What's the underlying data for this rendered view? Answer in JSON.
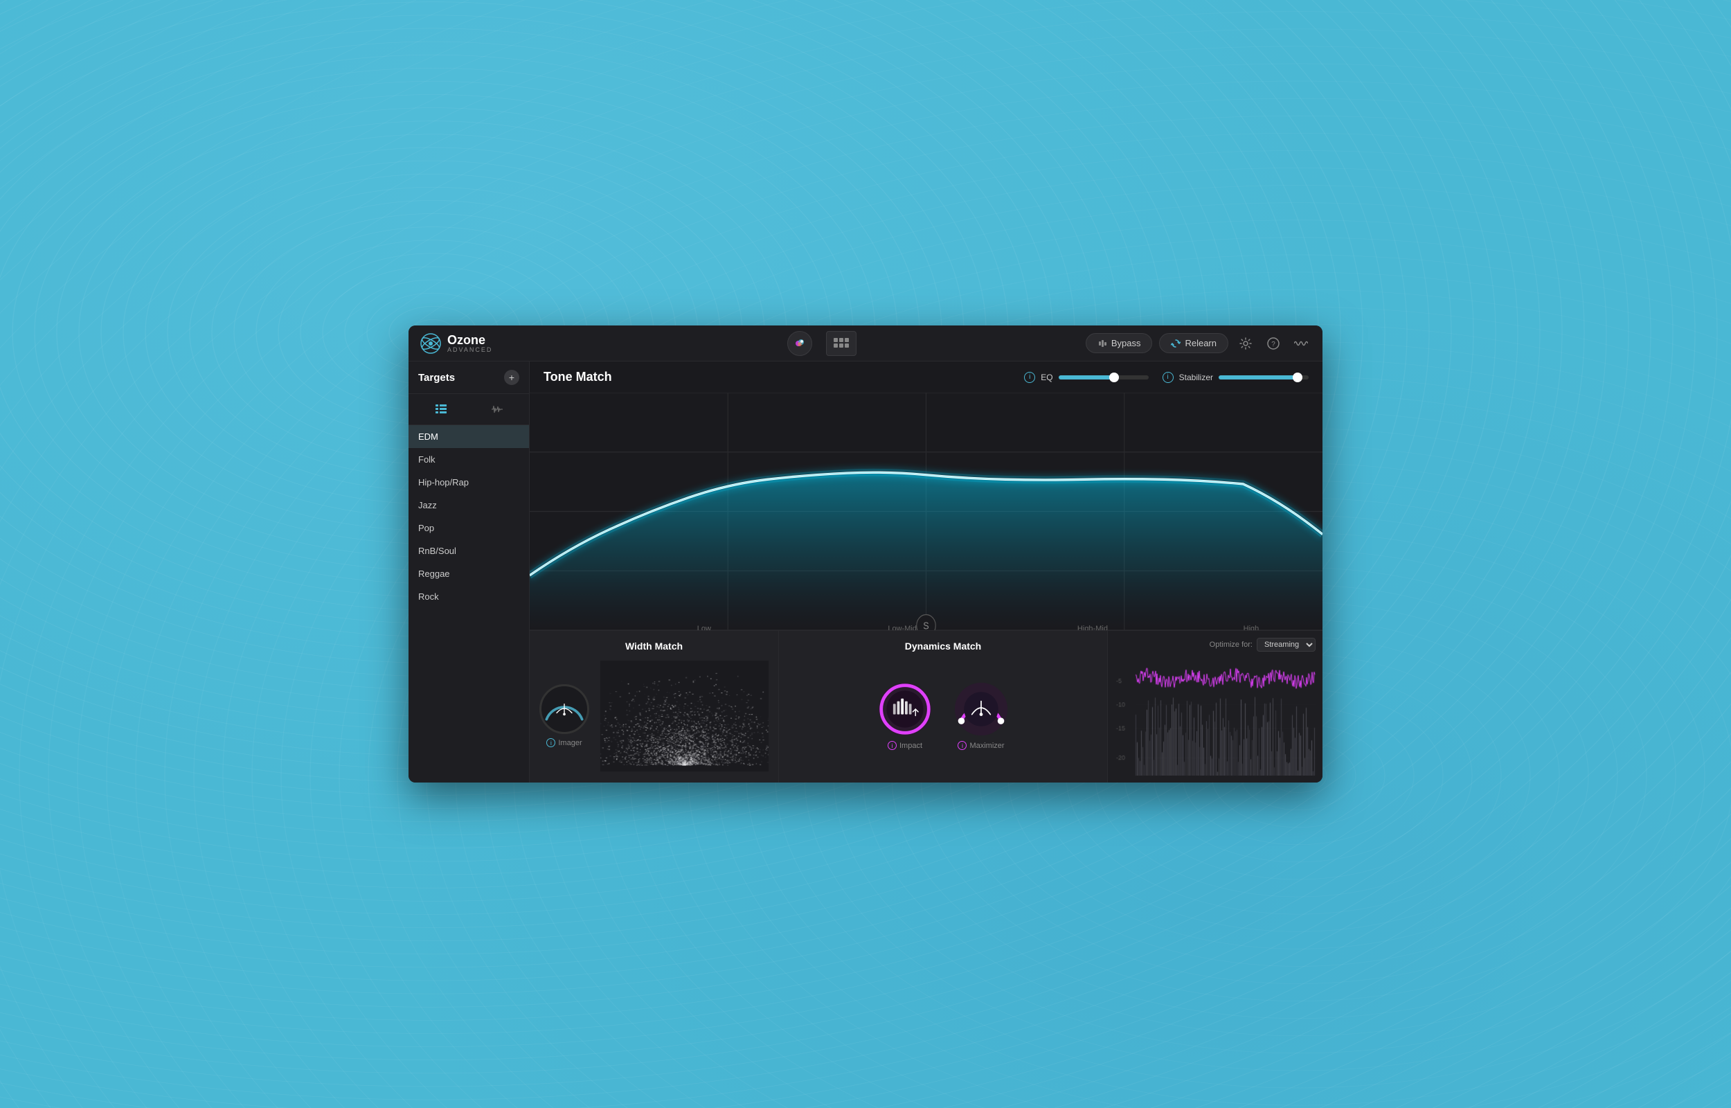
{
  "app": {
    "title": "Ozone",
    "subtitle": "ADVANCED",
    "header": {
      "bypass_label": "Bypass",
      "relearn_label": "Relearn",
      "optimize_label": "Optimize for:",
      "streaming_option": "Streaming"
    }
  },
  "sidebar": {
    "targets_title": "Targets",
    "items": [
      {
        "label": "EDM",
        "active": true
      },
      {
        "label": "Folk",
        "active": false
      },
      {
        "label": "Hip-hop/Rap",
        "active": false
      },
      {
        "label": "Jazz",
        "active": false
      },
      {
        "label": "Pop",
        "active": false
      },
      {
        "label": "RnB/Soul",
        "active": false
      },
      {
        "label": "Reggae",
        "active": false
      },
      {
        "label": "Rock",
        "active": false
      }
    ]
  },
  "tone_match": {
    "title": "Tone Match",
    "eq_label": "EQ",
    "stabilizer_label": "Stabilizer",
    "eq_value": 0.62,
    "stabilizer_value": 0.85,
    "freq_labels": [
      {
        "label": "Low",
        "left": "23%"
      },
      {
        "label": "Low-Mid",
        "left": "46%"
      },
      {
        "label": "High-Mid",
        "left": "69%"
      },
      {
        "label": "High",
        "left": "91%"
      }
    ]
  },
  "width_match": {
    "title": "Width Match",
    "imager_label": "Imager"
  },
  "dynamics_match": {
    "title": "Dynamics Match",
    "impact_label": "Impact",
    "maximizer_label": "Maximizer",
    "optimize_label": "Optimize for:",
    "streaming_option": "Streaming",
    "db_labels": [
      "-5",
      "-10",
      "-15",
      "-20"
    ]
  },
  "colors": {
    "cyan": "#4ab8d4",
    "pink": "#e040fb",
    "dark_bg": "#1a1a1e",
    "panel_bg": "#222226",
    "header_bg": "#1e1e22",
    "accent_cyan": "#00d4ff"
  }
}
